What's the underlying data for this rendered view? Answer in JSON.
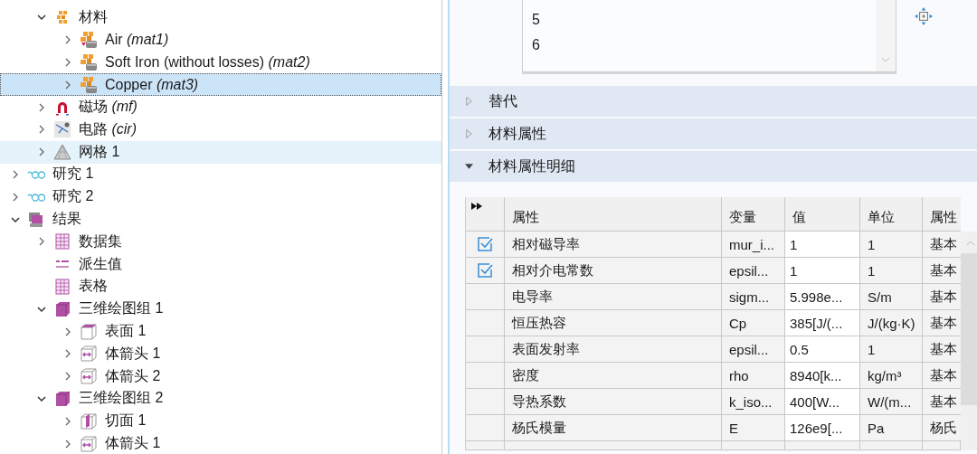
{
  "tree": {
    "component_children": [
      {
        "label": "材料",
        "kind": "materials",
        "expanded": true,
        "selected": false,
        "highlighted": false,
        "children": [
          {
            "label": "Air *(mat1)*",
            "kind": "material-air",
            "expanded": false,
            "selected": false,
            "highlighted": false
          },
          {
            "label": "Soft Iron (without losses) *(mat2)*",
            "kind": "material",
            "expanded": false,
            "selected": false,
            "highlighted": false
          },
          {
            "label": "Copper *(mat3)*",
            "kind": "material",
            "expanded": false,
            "selected": true,
            "highlighted": false
          }
        ]
      },
      {
        "label": "磁场 *(mf)*",
        "kind": "magnet",
        "expanded": false,
        "selected": false,
        "highlighted": false
      },
      {
        "label": "电路 *(cir)*",
        "kind": "circuit",
        "expanded": false,
        "selected": false,
        "highlighted": false
      },
      {
        "label": "网格 1",
        "kind": "mesh",
        "expanded": false,
        "selected": false,
        "highlighted": true
      }
    ],
    "items": [
      {
        "label": "研究 1",
        "kind": "study",
        "expanded": false,
        "selected": false,
        "highlighted": false
      },
      {
        "label": "研究 2",
        "kind": "study",
        "expanded": false,
        "selected": false,
        "highlighted": false
      },
      {
        "label": "结果",
        "kind": "results",
        "expanded": true,
        "selected": false,
        "highlighted": false,
        "children": [
          {
            "label": "数据集",
            "kind": "dataset",
            "expanded": false,
            "selected": false,
            "highlighted": false
          },
          {
            "label": "派生值",
            "kind": "derived",
            "selected": false,
            "highlighted": false
          },
          {
            "label": "表格",
            "kind": "table",
            "selected": false,
            "highlighted": false
          },
          {
            "label": "三维绘图组 1",
            "kind": "plotgroup",
            "expanded": true,
            "selected": false,
            "highlighted": false,
            "children": [
              {
                "label": "表面 1",
                "kind": "surface",
                "expanded": false,
                "selected": false,
                "highlighted": false
              },
              {
                "label": "体箭头 1",
                "kind": "arrow",
                "expanded": false,
                "selected": false,
                "highlighted": false
              },
              {
                "label": "体箭头 2",
                "kind": "arrow",
                "expanded": false,
                "selected": false,
                "highlighted": false
              }
            ]
          },
          {
            "label": "三维绘图组 2",
            "kind": "plotgroup",
            "expanded": true,
            "selected": false,
            "highlighted": false,
            "children": [
              {
                "label": "切面 1",
                "kind": "slice",
                "expanded": false,
                "selected": false,
                "highlighted": false
              },
              {
                "label": "体箭头 1",
                "kind": "arrow",
                "expanded": false,
                "selected": false,
                "highlighted": false
              }
            ]
          }
        ]
      }
    ]
  },
  "selection_list": {
    "items": [
      "5",
      "6"
    ]
  },
  "sections": [
    {
      "title": "替代",
      "expanded": false
    },
    {
      "title": "材料属性",
      "expanded": false
    },
    {
      "title": "材料属性明细",
      "expanded": true
    }
  ],
  "table": {
    "columns": [
      "属性",
      "变量",
      "值",
      "单位",
      "属性"
    ],
    "rows": [
      {
        "checked": true,
        "cells": [
          "相对磁导率",
          "mur_i...",
          "1",
          "1",
          "基本"
        ]
      },
      {
        "checked": true,
        "cells": [
          "相对介电常数",
          "epsil...",
          "1",
          "1",
          "基本"
        ]
      },
      {
        "checked": false,
        "cells": [
          "电导率",
          "sigm...",
          "5.998e...",
          "S/m",
          "基本"
        ]
      },
      {
        "checked": false,
        "cells": [
          "恒压热容",
          "Cp",
          "385[J/(...",
          "J/(kg·K)",
          "基本"
        ]
      },
      {
        "checked": false,
        "cells": [
          "表面发射率",
          "epsil...",
          "0.5",
          "1",
          "基本"
        ]
      },
      {
        "checked": false,
        "cells": [
          "密度",
          "rho",
          "8940[k...",
          "kg/m³",
          "基本"
        ]
      },
      {
        "checked": false,
        "cells": [
          "导热系数",
          "k_iso...",
          "400[W...",
          "W/(m...",
          "基本"
        ]
      },
      {
        "checked": false,
        "cells": [
          "杨氏模量",
          "E",
          "126e9[...",
          "Pa",
          "杨氏"
        ]
      }
    ]
  }
}
